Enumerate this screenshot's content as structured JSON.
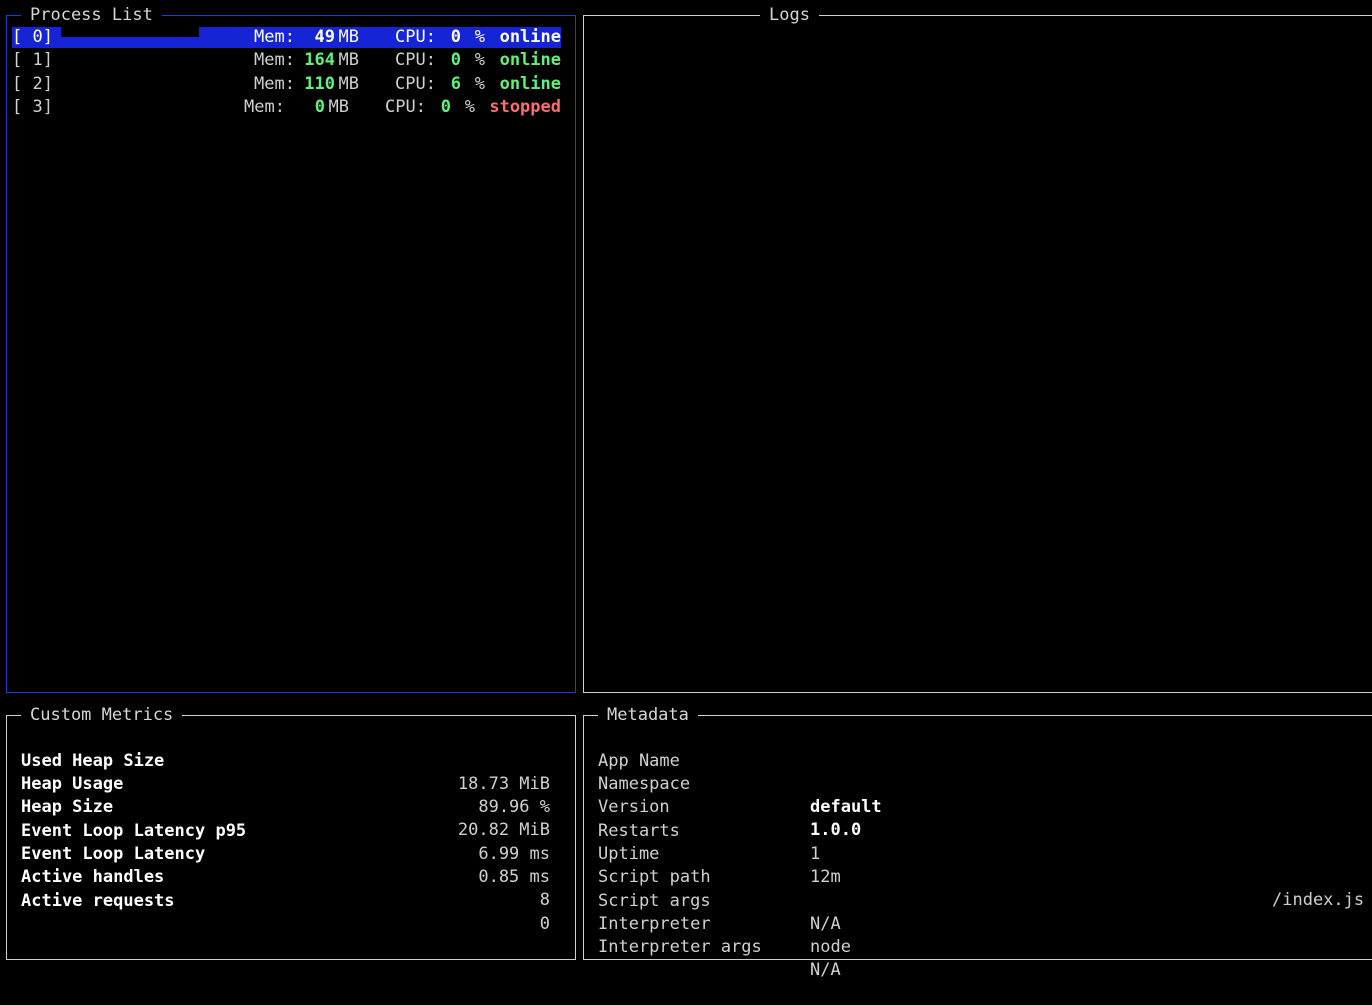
{
  "process_list": {
    "title": "Process List",
    "rows": [
      {
        "id": "[ 0]",
        "name": "",
        "mem_label": "Mem:",
        "mem": "49",
        "mem_unit": "MB",
        "cpu_label": "CPU:",
        "cpu": "0",
        "cpu_unit": "%",
        "status": "online"
      },
      {
        "id": "[ 1]",
        "name": "",
        "mem_label": "Mem:",
        "mem": "164",
        "mem_unit": "MB",
        "cpu_label": "CPU:",
        "cpu": "0",
        "cpu_unit": "%",
        "status": "online"
      },
      {
        "id": "[ 2]",
        "name": "",
        "mem_label": "Mem:",
        "mem": "110",
        "mem_unit": "MB",
        "cpu_label": "CPU:",
        "cpu": "6",
        "cpu_unit": "%",
        "status": "online"
      },
      {
        "id": "[ 3]",
        "name": "",
        "mem_label": "Mem:",
        "mem": "0",
        "mem_unit": "MB",
        "cpu_label": "CPU:",
        "cpu": "0",
        "cpu_unit": "%",
        "status": "stopped"
      }
    ]
  },
  "logs": {
    "title": "Logs"
  },
  "custom_metrics": {
    "title": "Custom Metrics",
    "rows": [
      {
        "name": "Used Heap Size",
        "value": "18.73 MiB"
      },
      {
        "name": "Heap Usage",
        "value": "89.96 %"
      },
      {
        "name": "Heap Size",
        "value": "20.82 MiB"
      },
      {
        "name": "Event Loop Latency p95",
        "value": "6.99 ms"
      },
      {
        "name": "Event Loop Latency",
        "value": "0.85 ms"
      },
      {
        "name": "Active handles",
        "value": "8"
      },
      {
        "name": "Active requests",
        "value": "0"
      }
    ]
  },
  "metadata": {
    "title": "Metadata",
    "rows": [
      {
        "key": "App Name",
        "value": ""
      },
      {
        "key": "Namespace",
        "value": "default"
      },
      {
        "key": "Version",
        "value": "1.0.0"
      },
      {
        "key": "Restarts",
        "value": "1"
      },
      {
        "key": "Uptime",
        "value": "12m"
      },
      {
        "key": "Script path",
        "value": "/index.js"
      },
      {
        "key": "Script args",
        "value": "N/A"
      },
      {
        "key": "Interpreter",
        "value": "node"
      },
      {
        "key": "Interpreter args",
        "value": "N/A"
      }
    ]
  },
  "colors": {
    "selection": "#1525d6",
    "online": "#5ff27a",
    "stopped": "#ff6b6b",
    "focused_border": "#1a3fd6"
  }
}
